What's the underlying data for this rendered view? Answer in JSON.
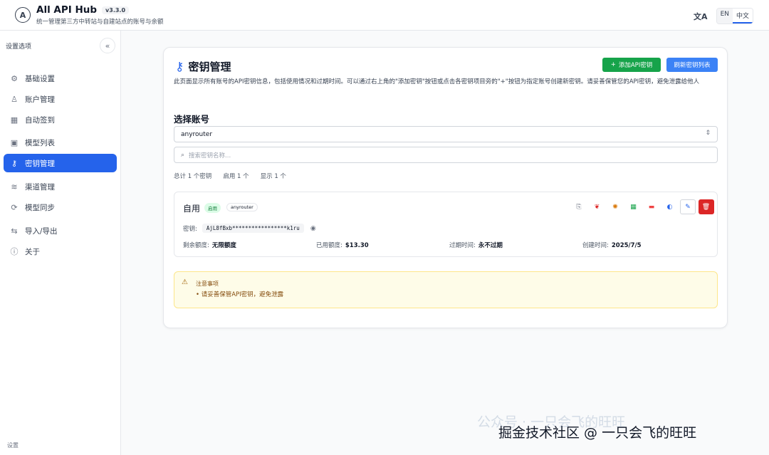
{
  "header": {
    "app_title": "All API Hub",
    "version": "v3.3.0",
    "subtitle": "统一管理第三方中转站与自建站点的账号与余额",
    "lang_en": "EN",
    "lang_zh": "中文"
  },
  "sidebar": {
    "title": "设置选项",
    "footer": "设置",
    "items": [
      {
        "label": "基础设置",
        "icon": "gear-icon"
      },
      {
        "label": "账户管理",
        "icon": "user-icon"
      },
      {
        "label": "自动签到",
        "icon": "calendar-icon"
      },
      {
        "label": "模型列表",
        "icon": "cpu-icon"
      },
      {
        "label": "密钥管理",
        "icon": "key-icon"
      },
      {
        "label": "渠道管理",
        "icon": "layers-icon"
      },
      {
        "label": "模型同步",
        "icon": "refresh-icon"
      },
      {
        "label": "导入/导出",
        "icon": "transfer-icon"
      },
      {
        "label": "关于",
        "icon": "info-icon"
      }
    ]
  },
  "main": {
    "title": "密钥管理",
    "add_button": "添加API密钥",
    "refresh_button": "刷新密钥列表",
    "description": "此页面显示所有账号的API密钥信息，包括使用情况和过期时间。可以通过右上角的\"添加密钥\"按钮或点击各密钥项目旁的\"+\"按钮为指定账号创建新密钥。请妥善保管您的API密钥，避免泄露给他人",
    "select_account_label": "选择账号",
    "selected_account": "anyrouter",
    "search_placeholder": "搜索密钥名称...",
    "stats": {
      "total": "总计 1 个密钥",
      "enabled": "启用 1 个",
      "shown": "显示 1 个"
    },
    "key": {
      "name": "自用",
      "status": "启用",
      "account": "anyrouter",
      "key_label": "密钥:",
      "key_value": "AjL8fBxb*****************k1ru",
      "remaining_label": "剩余额度:",
      "remaining_value": "无限额度",
      "used_label": "已用额度:",
      "used_value": "$13.30",
      "expire_label": "过期时间:",
      "expire_value": "永不过期",
      "created_label": "创建时间:",
      "created_value": "2025/7/5"
    },
    "notice": {
      "title": "注意事项",
      "item": "• 请妥善保管API密钥，避免泄露"
    }
  },
  "watermark": {
    "text": "掘金技术社区 @ 一只会飞的旺旺",
    "faint": "公众号 · 一只会飞的旺旺"
  }
}
